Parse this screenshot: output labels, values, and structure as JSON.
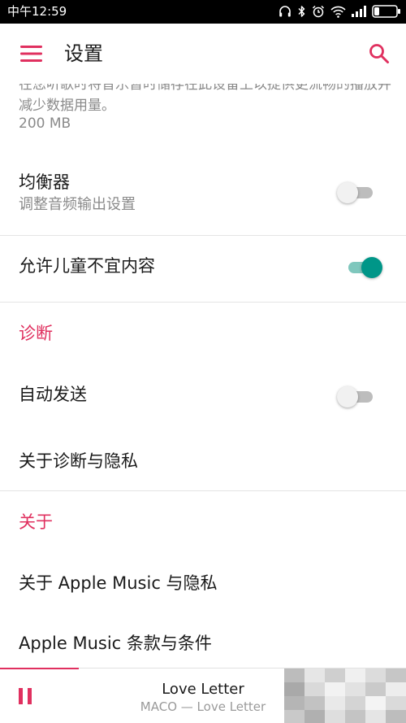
{
  "status_bar": {
    "time": "中午12:59",
    "icons": [
      "headphones-icon",
      "bluetooth-icon",
      "alarm-icon",
      "wifi-icon",
      "signal-icon",
      "battery-icon"
    ]
  },
  "app_bar": {
    "title": "设置",
    "menu_icon": "hamburger-menu-icon",
    "search_icon": "search-icon"
  },
  "colors": {
    "accent": "#e0305f",
    "toggle_on": "#009688"
  },
  "storage": {
    "description_cut": "在您听歌时将音乐暂时储存在此设备上以提供更流畅的播放并减少数据用量。",
    "value": "200 MB"
  },
  "equalizer": {
    "title": "均衡器",
    "subtitle": "调整音频输出设置",
    "enabled": false
  },
  "explicit": {
    "title": "允许儿童不宜内容",
    "enabled": true
  },
  "diagnostics": {
    "header": "诊断",
    "auto_send": {
      "title": "自动发送",
      "enabled": false
    },
    "about_privacy": "关于诊断与隐私"
  },
  "about": {
    "header": "关于",
    "about_privacy": "关于 Apple Music 与隐私",
    "terms": "Apple Music 条款与条件"
  },
  "player": {
    "title": "Love Letter",
    "subtitle": "MACO — Love Letter",
    "pause_icon": "pause-icon"
  }
}
